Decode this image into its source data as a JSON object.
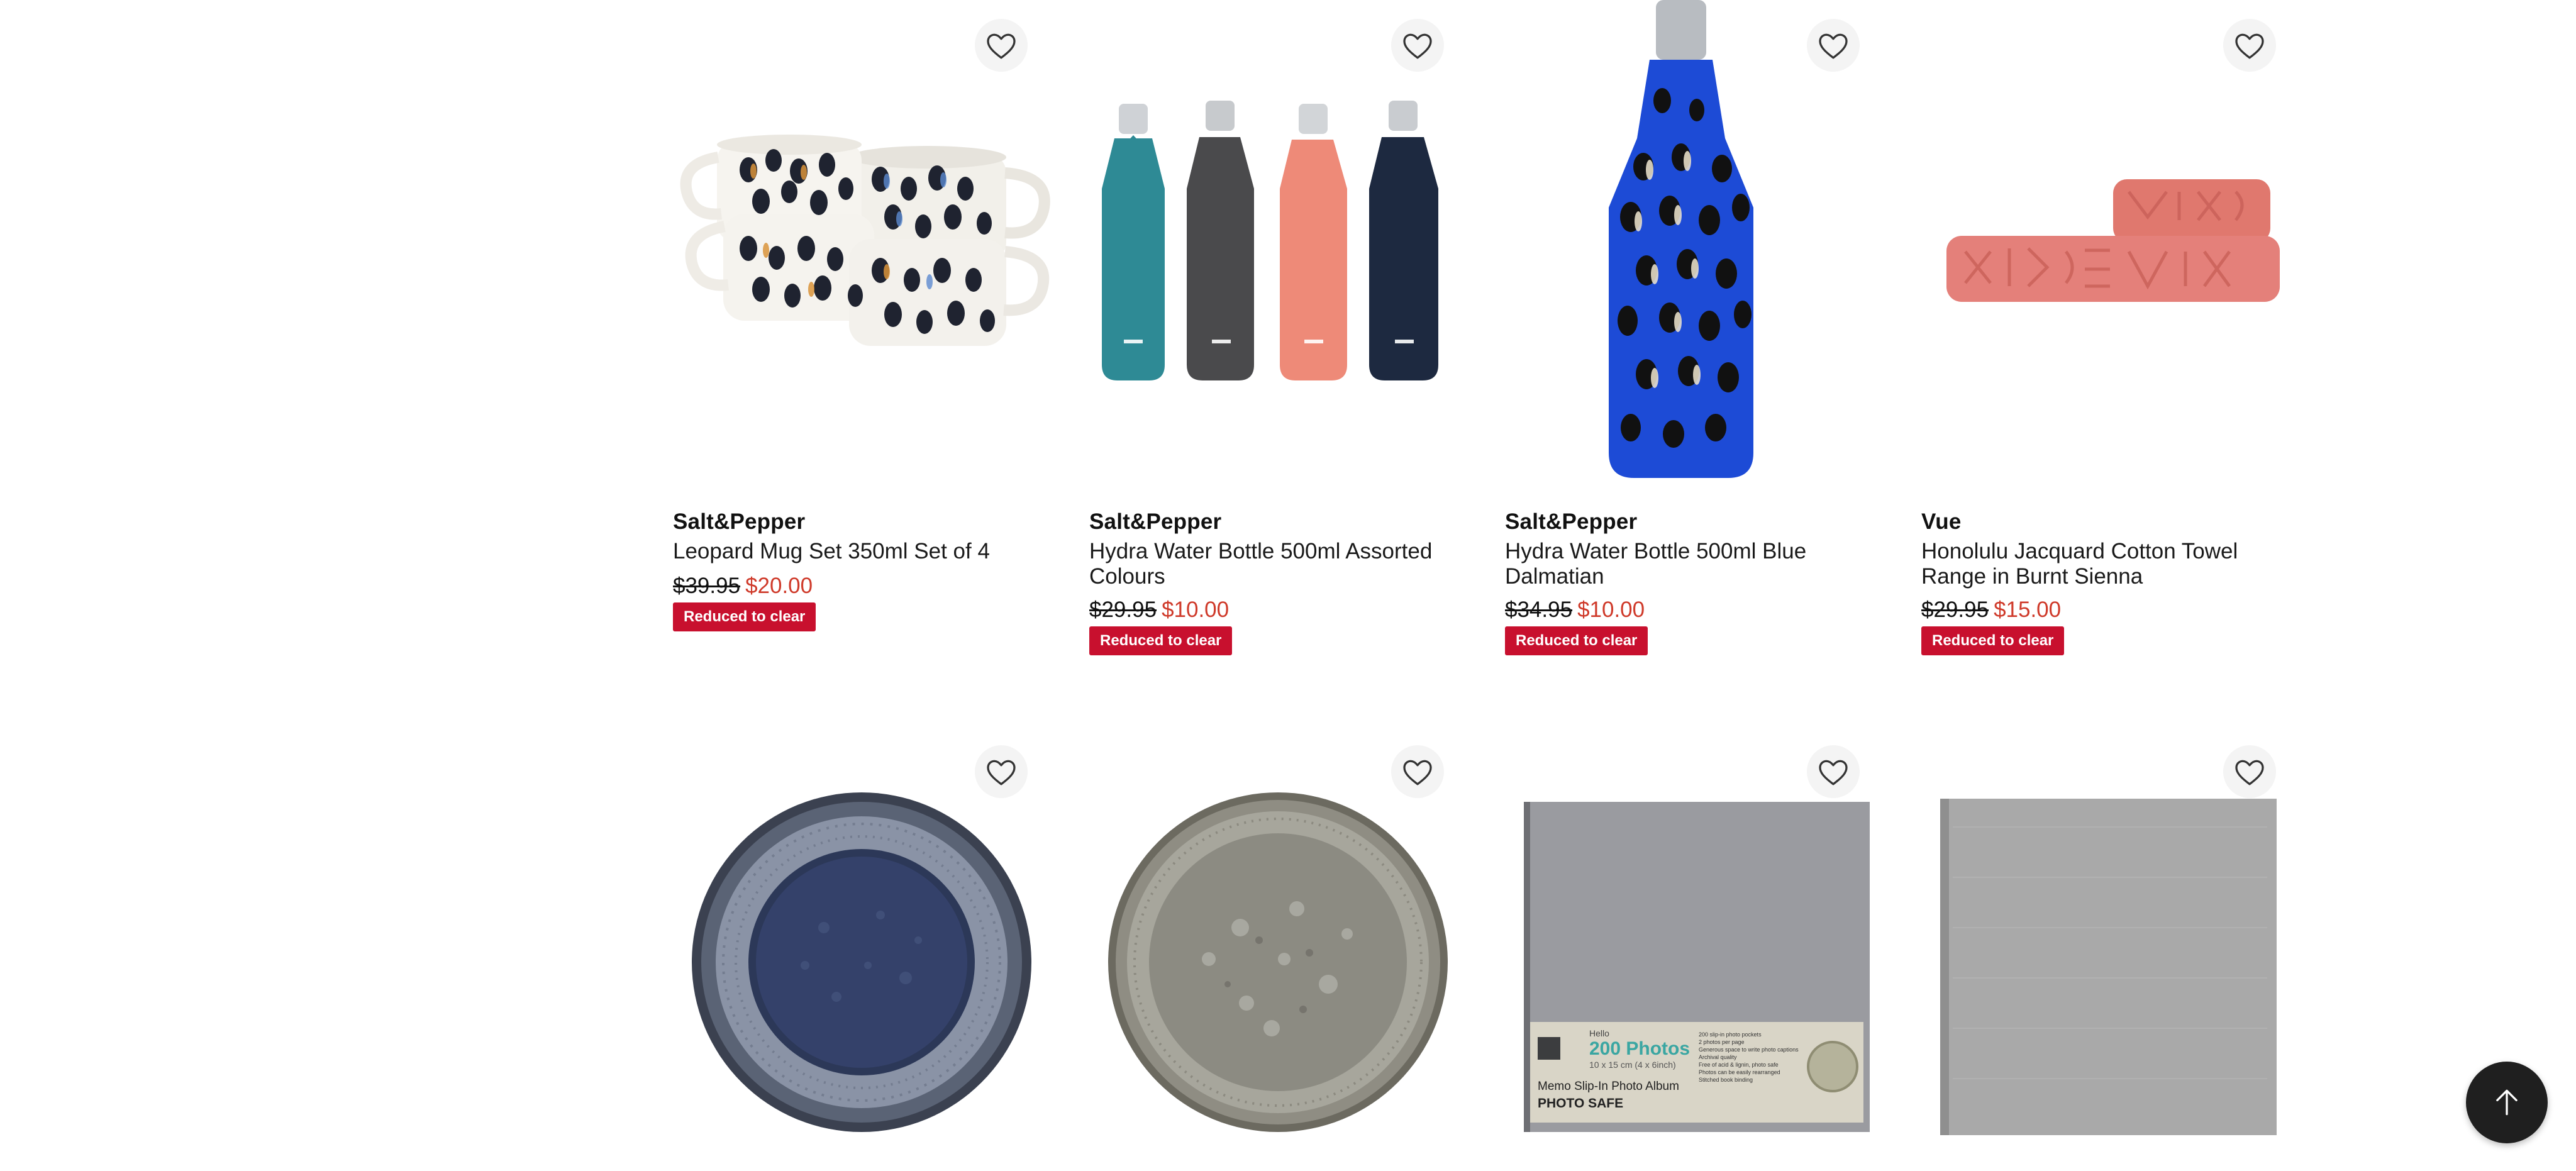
{
  "colors": {
    "sale_price": "#cf3a2a",
    "badge_bg": "#c8102e",
    "badge_text": "#ffffff",
    "back_to_top_bg": "#1f1f1f"
  },
  "icons": {
    "wishlist": "heart-outline-icon",
    "back_to_top": "arrow-up-icon"
  },
  "products": [
    {
      "brand": "Salt&Pepper",
      "name": "Leopard Mug Set 350ml Set of 4",
      "was_price": "$39.95",
      "now_price": "$20.00",
      "badge": "Reduced to clear"
    },
    {
      "brand": "Salt&Pepper",
      "name": "Hydra Water Bottle 500ml Assorted Colours",
      "was_price": "$29.95",
      "now_price": "$10.00",
      "badge": "Reduced to clear"
    },
    {
      "brand": "Salt&Pepper",
      "name": "Hydra Water Bottle 500ml Blue Dalmatian",
      "was_price": "$34.95",
      "now_price": "$10.00",
      "badge": "Reduced to clear"
    },
    {
      "brand": "Vue",
      "name": "Honolulu Jacquard Cotton Towel Range in Burnt Sienna",
      "was_price": "$29.95",
      "now_price": "$15.00",
      "badge": "Reduced to clear"
    }
  ],
  "album": {
    "brand": "Hello",
    "headline": "200 Photos",
    "size": "10 x 15 cm (4 x 6inch)",
    "title": "Memo Slip-In Photo Album",
    "subtitle": "PHOTO SAFE",
    "features": [
      "200 slip-in photo pockets",
      "2 photos per page",
      "Generous space to write photo captions",
      "Archival quality",
      "Free of acid & lignin, photo safe",
      "Photos can be easily rearranged",
      "Stitched book binding"
    ]
  }
}
